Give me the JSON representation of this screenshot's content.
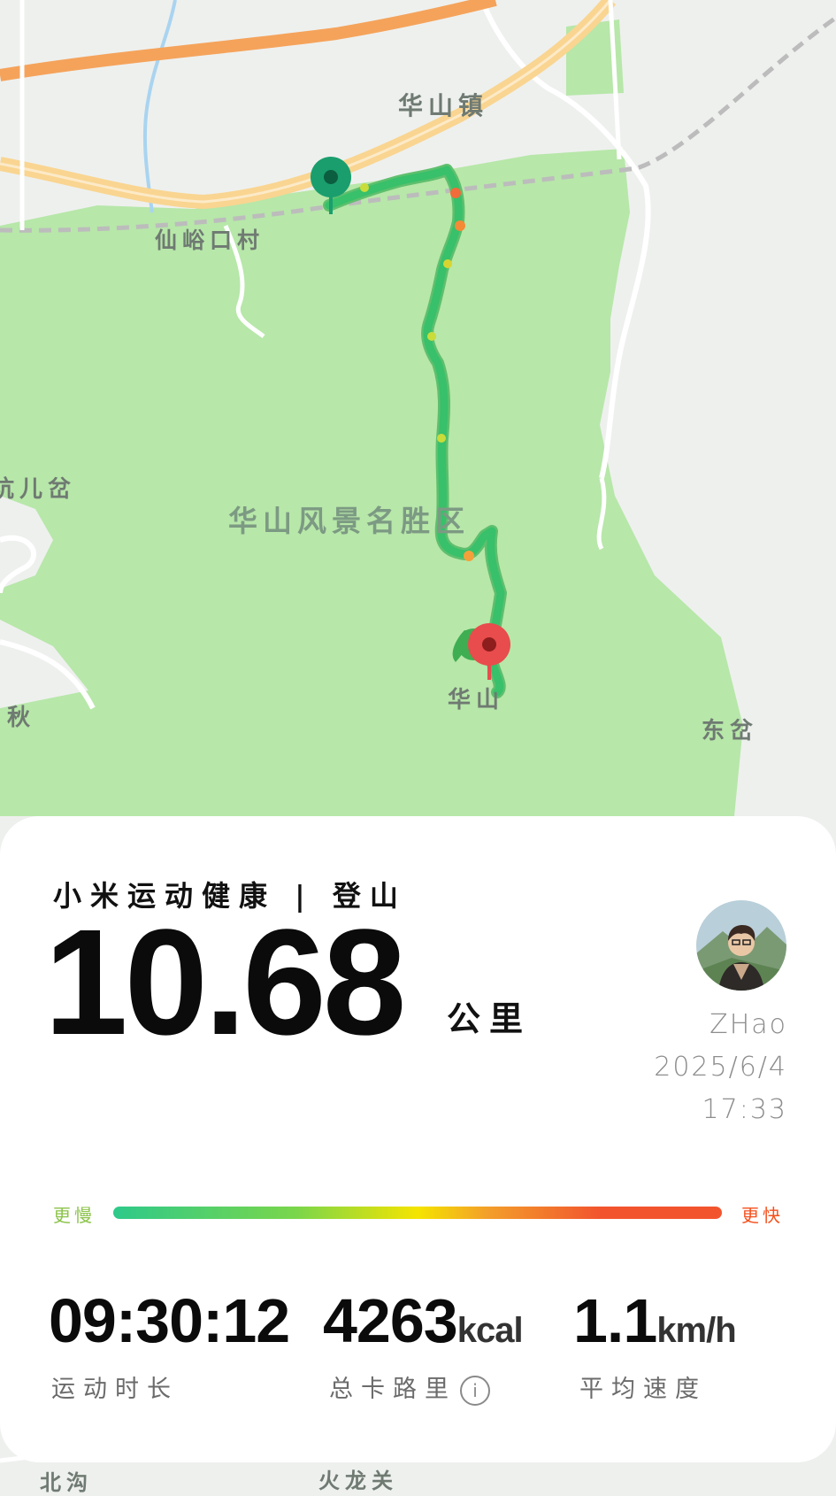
{
  "map": {
    "labels": {
      "town": "华山镇",
      "village": "仙峪口村",
      "scenic_area": "华山风景名胜区",
      "peak": "华山",
      "east": "东岔",
      "west_top": "坑儿岔",
      "west_mid": "秋",
      "bottom_left": "北沟",
      "bottom_mid": "火龙关"
    },
    "colors": {
      "park": "#b7e7a9",
      "land": "#eef0ee",
      "highway": "#f5a35b",
      "main_road": "#f9d591",
      "rail": "#bcbcbc",
      "river": "#a9d4f0",
      "start_pin": "#1a9e6e",
      "end_pin": "#e84c4c"
    }
  },
  "card": {
    "brand": "小米运动健康 | 登山",
    "distance_value": "10.68",
    "distance_unit": "公里",
    "user": {
      "name": "ZHao",
      "date": "2025/6/4",
      "time": "17:33"
    },
    "pace_legend": {
      "slow_label": "更慢",
      "fast_label": "更快",
      "slow_color": "#8bc34a",
      "fast_color": "#f4511e"
    },
    "stats": [
      {
        "value": "09:30:12",
        "unit": "",
        "label": "运动时长"
      },
      {
        "value": "4263",
        "unit": "kcal",
        "label": "总卡路里"
      },
      {
        "value": "1.1",
        "unit": "km/h",
        "label": "平均速度"
      }
    ],
    "info_icon": "i"
  }
}
